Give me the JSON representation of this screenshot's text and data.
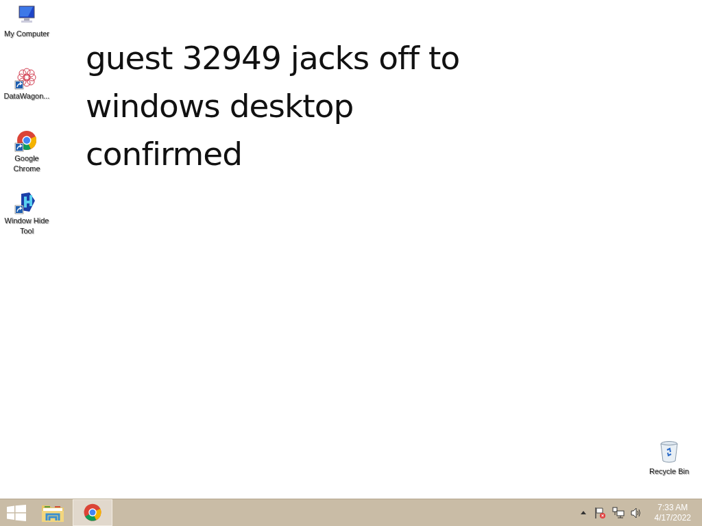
{
  "desktop_icons": [
    {
      "kind": "computer",
      "label": "My Computer",
      "shortcut": false
    },
    {
      "kind": "flower",
      "label": "DataWagon...",
      "shortcut": true
    },
    {
      "kind": "chrome",
      "label": "Google Chrome",
      "shortcut": true
    },
    {
      "kind": "windowhide",
      "label": "Window Hide Tool",
      "shortcut": true
    }
  ],
  "wallpaper_text": [
    "guest 32949 jacks off to",
    "windows desktop",
    "confirmed"
  ],
  "recycle_bin": {
    "label": "Recycle Bin"
  },
  "taskbar": {
    "buttons": [
      {
        "kind": "start",
        "selected": false
      },
      {
        "kind": "explorer",
        "selected": false
      },
      {
        "kind": "chrome",
        "selected": true
      }
    ],
    "tray": {
      "time": "7:33 AM",
      "date": "4/17/2022"
    }
  }
}
